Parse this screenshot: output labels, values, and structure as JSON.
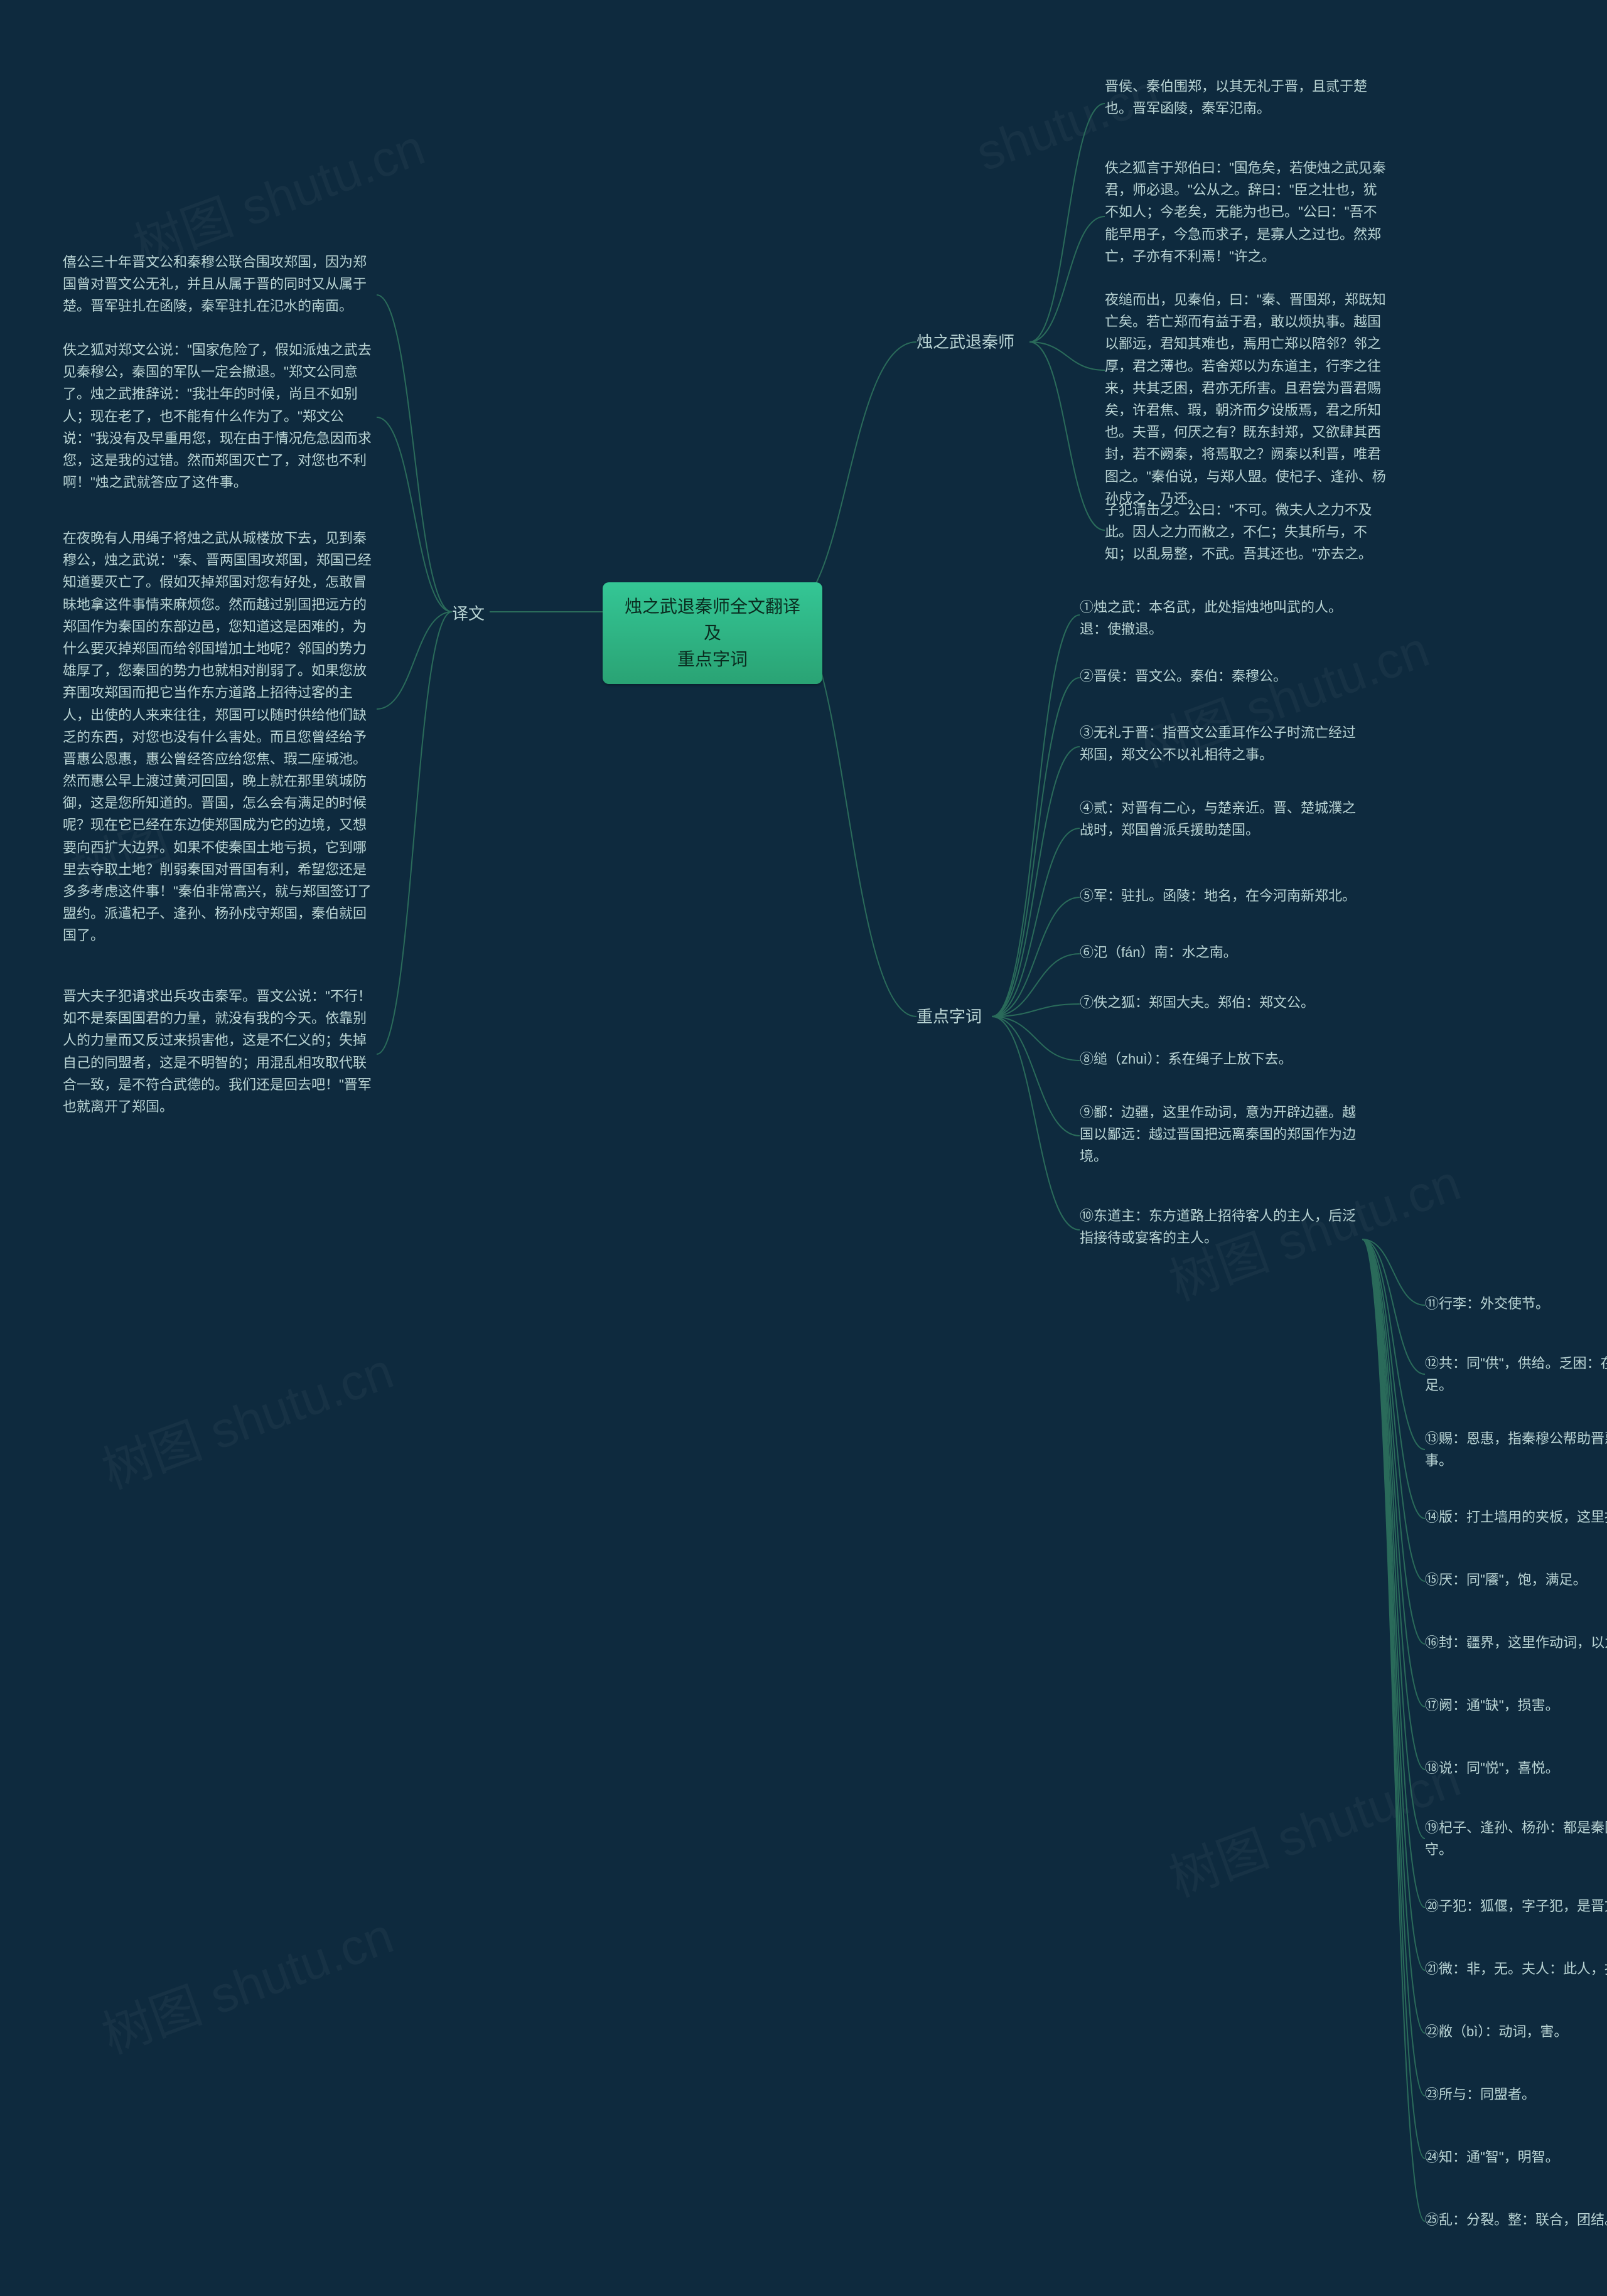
{
  "root": {
    "title_line1": "烛之武退秦师全文翻译及",
    "title_line2": "重点字词"
  },
  "branches": {
    "b1": "烛之武退秦师",
    "b2": "译文",
    "b3": "重点字词"
  },
  "original": {
    "p1": "晋侯、秦伯围郑，以其无礼于晋，且贰于楚也。晋军函陵，秦军氾南。",
    "p2": "佚之狐言于郑伯曰：\"国危矣，若使烛之武见秦君，师必退。\"公从之。辞曰：\"臣之壮也，犹不如人；今老矣，无能为也已。\"公曰：\"吾不能早用子，今急而求子，是寡人之过也。然郑亡，子亦有不利焉！\"许之。",
    "p3": "夜缒而出，见秦伯，曰：\"秦、晋围郑，郑既知亡矣。若亡郑而有益于君，敢以烦执事。越国以鄙远，君知其难也，焉用亡郑以陪邻？邻之厚，君之薄也。若舍郑以为东道主，行李之往来，共其乏困，君亦无所害。且君尝为晋君赐矣，许君焦、瑕，朝济而夕设版焉，君之所知也。夫晋，何厌之有？既东封郑，又欲肆其西封，若不阙秦，将焉取之？阙秦以利晋，唯君图之。\"秦伯说，与郑人盟。使杞子、逢孙、杨孙戍之，乃还。",
    "p4": "子犯请击之。公曰：\"不可。微夫人之力不及此。因人之力而敝之，不仁；失其所与，不知；以乱易整，不武。吾其还也。\"亦去之。"
  },
  "translation": {
    "p1": "僖公三十年晋文公和秦穆公联合围攻郑国，因为郑国曾对晋文公无礼，并且从属于晋的同时又从属于楚。晋军驻扎在函陵，秦军驻扎在氾水的南面。",
    "p2": "佚之狐对郑文公说：\"国家危险了，假如派烛之武去见秦穆公，秦国的军队一定会撤退。\"郑文公同意了。烛之武推辞说：\"我壮年的时候，尚且不如别人；现在老了，也不能有什么作为了。\"郑文公说：\"我没有及早重用您，现在由于情况危急因而求您，这是我的过错。然而郑国灭亡了，对您也不利啊！\"烛之武就答应了这件事。",
    "p3": "在夜晚有人用绳子将烛之武从城楼放下去，见到秦穆公，烛之武说：\"秦、晋两国围攻郑国，郑国已经知道要灭亡了。假如灭掉郑国对您有好处，怎敢冒昧地拿这件事情来麻烦您。然而越过别国把远方的郑国作为秦国的东部边邑，您知道这是困难的，为什么要灭掉郑国而给邻国增加土地呢？邻国的势力雄厚了，您秦国的势力也就相对削弱了。如果您放弃围攻郑国而把它当作东方道路上招待过客的主人，出使的人来来往往，郑国可以随时供给他们缺乏的东西，对您也没有什么害处。而且您曾经给予晋惠公恩惠，惠公曾经答应给您焦、瑕二座城池。然而惠公早上渡过黄河回国，晚上就在那里筑城防御，这是您所知道的。晋国，怎么会有满足的时候呢？现在它已经在东边使郑国成为它的边境，又想要向西扩大边界。如果不使秦国土地亏损，它到哪里去夺取土地？削弱秦国对晋国有利，希望您还是多多考虑这件事！\"秦伯非常高兴，就与郑国签订了盟约。派遣杞子、逢孙、杨孙戍守郑国，秦伯就回国了。",
    "p4": "晋大夫子犯请求出兵攻击秦军。晋文公说：\"不行！如不是秦国国君的力量，就没有我的今天。依靠别人的力量而又反过来损害他，这是不仁义的；失掉自己的同盟者，这是不明智的；用混乱相攻取代联合一致，是不符合武德的。我们还是回去吧！\"晋军也就离开了郑国。"
  },
  "keywords": {
    "k1": "①烛之武：本名武，此处指烛地叫武的人。退：使撤退。",
    "k2": "②晋侯：晋文公。秦伯：秦穆公。",
    "k3": "③无礼于晋：指晋文公重耳作公子时流亡经过郑国，郑文公不以礼相待之事。",
    "k4": "④贰：对晋有二心，与楚亲近。晋、楚城濮之战时，郑国曾派兵援助楚国。",
    "k5": "⑤军：驻扎。函陵：地名，在今河南新郑北。",
    "k6": "⑥氾（fán）南：水之南。",
    "k7": "⑦佚之狐：郑国大夫。郑伯：郑文公。",
    "k8": "⑧缒（zhuì）：系在绳子上放下去。",
    "k9": "⑨鄙：边疆，这里作动词，意为开辟边疆。越国以鄙远：越过晋国把远离秦国的郑国作为边境。",
    "k10": "⑩东道主：东方道路上招待客人的主人，后泛指接待或宴客的主人。",
    "k11": "⑪行李：外交使节。",
    "k12": "⑫共：同\"供\"，供给。乏困：在食宿方面的不足。",
    "k13": "⑬赐：恩惠，指秦穆公帮助晋惠公回国继位之事。",
    "k14": "⑭版：打土墙用的夹板，这里指防御工事。",
    "k15": "⑮厌：同\"餍\"，饱，满足。",
    "k16": "⑯封：疆界，这里作动词，以为疆界。",
    "k17": "⑰阙：通\"缺\"，损害。",
    "k18": "⑱说：同\"悦\"，喜悦。",
    "k19": "⑲杞子、逢孙、杨孙：都是秦国大夫。戍：防守。",
    "k20": "⑳子犯：狐偃，字子犯，是晋文公的舅父。",
    "k21": "㉑微：非，无。夫人：此人，指秦穆公。",
    "k22": "㉒敝（bì）：动词，害。",
    "k23": "㉓所与：同盟者。",
    "k24": "㉔知：通\"智\"，明智。",
    "k25": "㉕乱：分裂。整：联合，团结。"
  },
  "watermarks": {
    "w1": "树图 shutu.cn",
    "w2": "树图 shutu.cn",
    "w3": "树图 shutu.cn",
    "w4": "树图 shutu.cn",
    "w5": "shutu.cn",
    "w6": "树图 shutu.cn",
    "w7": "树图 shutu.cn",
    "w8": "树图"
  }
}
